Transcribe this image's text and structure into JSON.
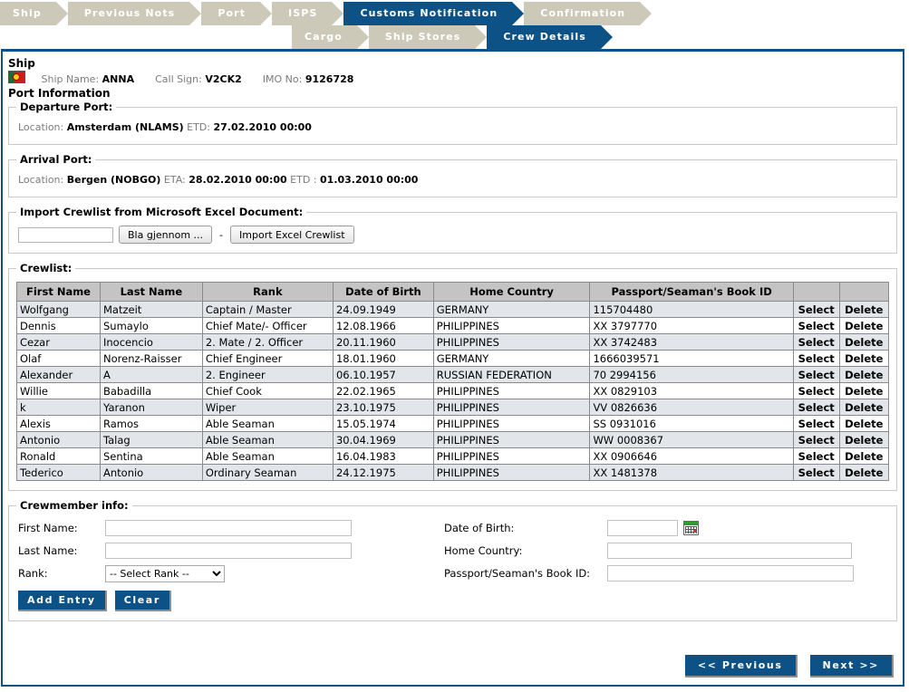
{
  "breadcrumb": {
    "row1": [
      {
        "label": "Ship",
        "active": false
      },
      {
        "label": "Previous Nots",
        "active": false
      },
      {
        "label": "Port",
        "active": false
      },
      {
        "label": "ISPS",
        "active": false
      },
      {
        "label": "Customs Notification",
        "active": true
      },
      {
        "label": "Confirmation",
        "active": false
      }
    ],
    "row2": [
      {
        "label": "Cargo",
        "active": false
      },
      {
        "label": "Ship Stores",
        "active": false
      },
      {
        "label": "Crew Details",
        "active": true
      }
    ]
  },
  "ship": {
    "heading": "Ship",
    "flag_icon": "portugal-flag-icon",
    "name_label": "Ship Name:",
    "name_value": "ANNA",
    "callsign_label": "Call Sign:",
    "callsign_value": "V2CK2",
    "imo_label": "IMO No:",
    "imo_value": "9126728"
  },
  "port_information": {
    "heading": "Port Information",
    "departure": {
      "legend": "Departure Port:",
      "location_label": "Location:",
      "location_value": "Amsterdam (NLAMS)",
      "etd_label": "ETD:",
      "etd_value": "27.02.2010 00:00"
    },
    "arrival": {
      "legend": "Arrival Port:",
      "location_label": "Location:",
      "location_value": "Bergen (NOBGO)",
      "eta_label": "ETA:",
      "eta_value": "28.02.2010 00:00",
      "etd_label": "ETD :",
      "etd_value": "01.03.2010 00:00"
    }
  },
  "import": {
    "legend": "Import Crewlist from Microsoft Excel Document:",
    "file_value": "",
    "browse_label": "Bla gjennom ...",
    "separator": "-",
    "import_label": "Import Excel Crewlist"
  },
  "crewlist": {
    "legend": "Crewlist:",
    "columns": [
      "First Name",
      "Last Name",
      "Rank",
      "Date of Birth",
      "Home Country",
      "Passport/Seaman's Book ID",
      "",
      ""
    ],
    "select_label": "Select",
    "delete_label": "Delete",
    "rows": [
      {
        "first": "Wolfgang",
        "last": "Matzeit",
        "rank": "Captain / Master",
        "dob": "24.09.1949",
        "country": "GERMANY",
        "passport": "115704480"
      },
      {
        "first": "Dennis",
        "last": "Sumaylo",
        "rank": "Chief Mate/- Officer",
        "dob": "12.08.1966",
        "country": "PHILIPPINES",
        "passport": "XX 3797770"
      },
      {
        "first": "Cezar",
        "last": "Inocencio",
        "rank": "2. Mate / 2. Officer",
        "dob": "20.11.1960",
        "country": "PHILIPPINES",
        "passport": "XX 3742483"
      },
      {
        "first": "Olaf",
        "last": "Norenz-Raisser",
        "rank": "Chief Engineer",
        "dob": "18.01.1960",
        "country": "GERMANY",
        "passport": "1666039571"
      },
      {
        "first": "Alexander",
        "last": "A",
        "rank": "2. Engineer",
        "dob": "06.10.1957",
        "country": "RUSSIAN FEDERATION",
        "passport": "70 2994156"
      },
      {
        "first": "Willie",
        "last": "Babadilla",
        "rank": "Chief Cook",
        "dob": "22.02.1965",
        "country": "PHILIPPINES",
        "passport": "XX 0829103"
      },
      {
        "first": "k",
        "last": "Yaranon",
        "rank": "Wiper",
        "dob": "23.10.1975",
        "country": "PHILIPPINES",
        "passport": "VV 0826636"
      },
      {
        "first": "Alexis",
        "last": "Ramos",
        "rank": "Able Seaman",
        "dob": "15.05.1974",
        "country": "PHILIPPINES",
        "passport": "SS 0931016"
      },
      {
        "first": "Antonio",
        "last": "Talag",
        "rank": "Able Seaman",
        "dob": "30.04.1969",
        "country": "PHILIPPINES",
        "passport": "WW 0008367"
      },
      {
        "first": "Ronald",
        "last": "Sentina",
        "rank": "Able Seaman",
        "dob": "16.04.1983",
        "country": "PHILIPPINES",
        "passport": "XX 0906646"
      },
      {
        "first": "Tederico",
        "last": "Antonio",
        "rank": "Ordinary Seaman",
        "dob": "24.12.1975",
        "country": "PHILIPPINES",
        "passport": "XX 1481378"
      }
    ]
  },
  "crewmember_info": {
    "legend": "Crewmember info:",
    "first_name_label": "First Name:",
    "first_name_value": "",
    "last_name_label": "Last Name:",
    "last_name_value": "",
    "rank_label": "Rank:",
    "rank_selected": "-- Select Rank --",
    "dob_label": "Date of Birth:",
    "dob_value": "",
    "calendar_icon": "calendar-icon",
    "country_label": "Home Country:",
    "country_value": "",
    "passport_label": "Passport/Seaman's Book ID:",
    "passport_value": "",
    "add_entry_label": "Add Entry",
    "clear_label": "Clear"
  },
  "navigation": {
    "previous_label": "<< Previous",
    "next_label": "Next >>"
  },
  "colors": {
    "accent_blue": "#0d5286",
    "crumb_inactive": "#cdc9b8",
    "table_header": "#c4c4c4",
    "row_odd": "#e2e6ea"
  }
}
